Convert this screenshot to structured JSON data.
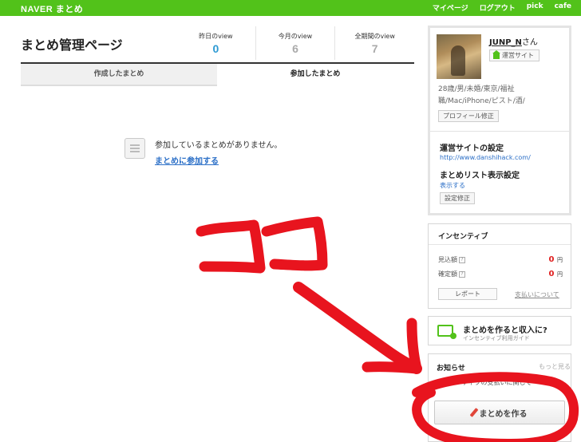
{
  "header": {
    "logo": "NAVER まとめ",
    "nav": [
      "マイページ",
      "ログアウト",
      "pick",
      "cafe"
    ]
  },
  "main": {
    "title": "まとめ管理ページ",
    "stats": [
      {
        "label": "昨日のview",
        "value": "0"
      },
      {
        "label": "今月のview",
        "value": "6"
      },
      {
        "label": "全期間のview",
        "value": "7"
      }
    ],
    "tabs": [
      {
        "label": "作成したまとめ"
      },
      {
        "label": "参加したまとめ"
      }
    ],
    "empty_message": "参加しているまとめがありません。",
    "empty_link": "まとめに参加する"
  },
  "sidebar": {
    "profile": {
      "name": "JUNP_N",
      "name_suffix": "さん",
      "site_button": "運営サイト",
      "bio_line1": "28歳/男/未婚/東京/福祉",
      "bio_line2": "職/Mac/iPhone/ピスト/酒/",
      "edit_button": "プロフィール修正",
      "site_settings_title": "運営サイトの設定",
      "site_url": "http://www.danshihack.com/",
      "list_settings_title": "まとめリスト表示設定",
      "list_setting_value": "表示する",
      "settings_edit_button": "設定修正"
    },
    "incentive": {
      "title": "インセンティブ",
      "rows": [
        {
          "label": "見込額",
          "amount": "0",
          "unit": "円"
        },
        {
          "label": "確定額",
          "amount": "0",
          "unit": "円"
        }
      ],
      "report_button": "レポート",
      "payment_link": "支払いについて"
    },
    "guide": {
      "title": "まとめを作ると収入に?",
      "subtitle": "インセンティブ利用ガイド"
    },
    "news": {
      "title": "お知らせ",
      "more": "もっと見る",
      "item": "インセンティブの支払いに関して"
    },
    "create_button": "まとめを作る"
  },
  "annotation": {
    "text": "ココ",
    "color": "#e8141e"
  }
}
